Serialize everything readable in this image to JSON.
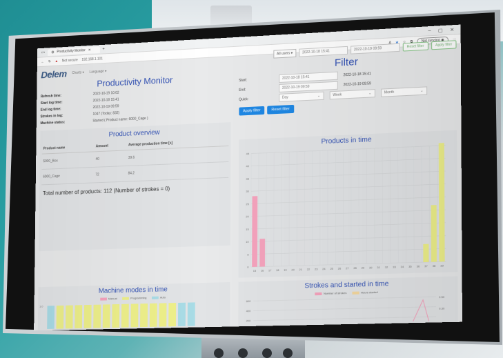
{
  "browser": {
    "tab_title": "Productivity Monitor",
    "new_tab": "+",
    "security_label": "Not secure",
    "url": "192.168.1.101",
    "profile_label": "Not syncing",
    "window_controls": [
      "–",
      "▢",
      "✕"
    ]
  },
  "nav": {
    "logo": "Delem",
    "charts": "Charts ▾",
    "language": "Language ▾"
  },
  "monitor": {
    "title": "Productivity Monitor",
    "rows": [
      {
        "label": "Refresh time:",
        "value": "2022-10-19 10:02"
      },
      {
        "label": "Start log time:",
        "value": "2022-10-18 15:41"
      },
      {
        "label": "End log time:",
        "value": "2022-10-19 09:59"
      },
      {
        "label": "Strokes in log:",
        "value": "1047 (Today: 832)"
      },
      {
        "label": "Machine status:",
        "value": "Started ( Product name: 6000_Cage )"
      }
    ]
  },
  "overview": {
    "title": "Product overview",
    "headers": [
      "Product name",
      "Amount",
      "Average production time [s]"
    ],
    "rows": [
      [
        "5000_Box",
        "40",
        "39.6"
      ],
      [
        "6000_Cage",
        "72",
        "84.2"
      ]
    ],
    "total": "Total number of products: 112 (Number of strokes = 0)"
  },
  "machine_modes": {
    "title": "Machine modes in time",
    "legend": [
      "Manual",
      "Programming",
      "Auto"
    ],
    "colors": [
      "#f5a3bd",
      "#eef08a",
      "#a9dce6"
    ]
  },
  "topbar": {
    "select": "All users",
    "start_value": "2022-10-18 15:41",
    "end_value": "2022-10-19 09:59",
    "reset": "Reset filter",
    "apply": "Apply filter"
  },
  "filter": {
    "title": "Filter",
    "start_label": "Start:",
    "start_value": "2022-10-18 15:41",
    "start_echo": "2022-10-18 15:41",
    "end_label": "End:",
    "end_value": "2022-10-19 09:59",
    "end_echo": "2022-10-19 09:59",
    "quick_label": "Quick:",
    "quick_day": "Day",
    "quick_week": "Week",
    "quick_month": "Month",
    "apply": "Apply filter",
    "reset": "Reset filter"
  },
  "chart_data": [
    {
      "type": "bar",
      "title": "Products in time",
      "categories": [
        "15",
        "16",
        "17",
        "18",
        "19",
        "20",
        "21",
        "22",
        "23",
        "24",
        "25",
        "26",
        "27",
        "28",
        "29",
        "30",
        "31",
        "32",
        "33",
        "34",
        "35",
        "36",
        "37",
        "38",
        "39"
      ],
      "series": [
        {
          "values": [
            28,
            11,
            0,
            0,
            0,
            0,
            0,
            0,
            0,
            0,
            0,
            0,
            0,
            0,
            0,
            0,
            0,
            0,
            0,
            0,
            0,
            0,
            1,
            0,
            0
          ],
          "color": "#f5a3bd"
        },
        {
          "values": [
            0,
            0,
            0,
            0,
            0,
            0,
            0,
            0,
            0,
            0,
            0,
            0,
            0,
            0,
            0,
            0,
            0,
            0,
            0,
            0,
            0,
            0,
            7,
            22,
            46
          ],
          "color": "#eef08a"
        }
      ],
      "yticks": [
        "0",
        "5",
        "10",
        "15",
        "20",
        "25",
        "30",
        "35",
        "40",
        "45"
      ],
      "ylim": [
        0,
        45
      ],
      "grid": true
    },
    {
      "type": "line",
      "title": "Strokes and started in time",
      "legend": [
        "Number of strokes",
        "Hours started"
      ],
      "colors": [
        "#f5a3bd",
        "#f5d9a0"
      ],
      "yticks_left": [
        "600",
        "400",
        "200"
      ],
      "yticks_right": [
        "0.50",
        "0.30"
      ]
    }
  ]
}
